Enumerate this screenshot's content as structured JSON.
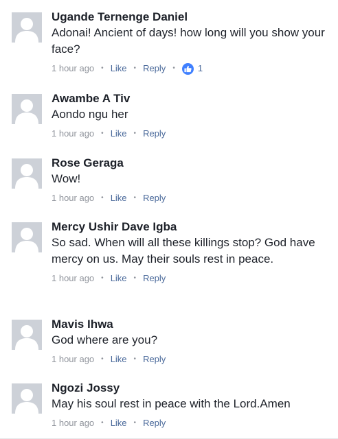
{
  "comments": [
    {
      "author": "Ugande Ternenge Daniel",
      "text": "Adonai! Ancient of days!  how long will you show your face?",
      "time": "1 hour ago",
      "like_label": "Like",
      "reply_label": "Reply",
      "reaction_count": "1"
    },
    {
      "author": "Awambe A Tiv",
      "text": "Aondo ngu her",
      "time": "1 hour ago",
      "like_label": "Like",
      "reply_label": "Reply"
    },
    {
      "author": "Rose Geraga",
      "text": "Wow!",
      "time": "1 hour ago",
      "like_label": "Like",
      "reply_label": "Reply"
    },
    {
      "author": "Mercy Ushir Dave Igba",
      "text": "So sad. When will all these killings stop? God have mercy on us. May their souls rest in peace.",
      "time": "1 hour ago",
      "like_label": "Like",
      "reply_label": "Reply"
    },
    {
      "author": "Mavis Ihwa",
      "text": "God where are you?",
      "time": "1 hour ago",
      "like_label": "Like",
      "reply_label": "Reply"
    },
    {
      "author": "Ngozi Jossy",
      "text": "May his soul rest in peace with the Lord.Amen",
      "time": "1 hour ago",
      "like_label": "Like",
      "reply_label": "Reply"
    }
  ],
  "separator": "•",
  "colors": {
    "name": "#1d2129",
    "meta": "#90949c",
    "action": "#4b6a9b",
    "like_badge": "#4080ff",
    "avatar_bg": "#cdd1d8"
  }
}
